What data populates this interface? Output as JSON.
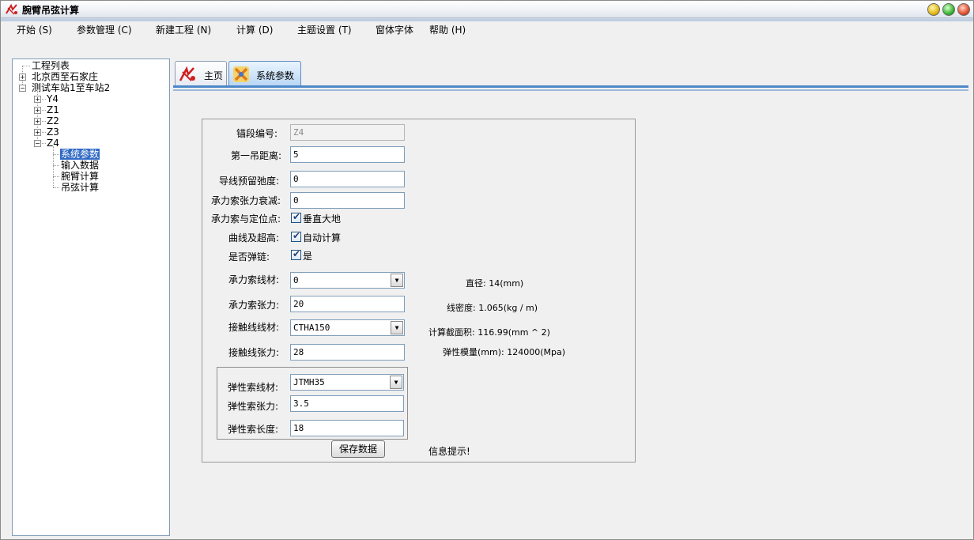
{
  "window": {
    "title": "腕臂吊弦计算"
  },
  "menu": [
    "开始 (S)",
    "参数管理 (C)",
    "新建工程 (N)",
    "计算 (D)",
    "主题设置 (T)",
    "窗体字体",
    "帮助 (H)"
  ],
  "tree": {
    "root": "工程列表",
    "projects": [
      {
        "label": "北京西至石家庄",
        "expander": "+"
      },
      {
        "label": "测试车站1至车站2",
        "expander": "−"
      }
    ],
    "stations": [
      {
        "label": "Y4",
        "expander": "+"
      },
      {
        "label": "Z1",
        "expander": "+"
      },
      {
        "label": "Z2",
        "expander": "+"
      },
      {
        "label": "Z3",
        "expander": "+"
      },
      {
        "label": "Z4",
        "expander": "−"
      }
    ],
    "leaves": [
      "系统参数",
      "输入数据",
      "腕臂计算",
      "吊弦计算"
    ],
    "selected": "系统参数"
  },
  "tabs": [
    {
      "label": "主页"
    },
    {
      "label": "系统参数"
    }
  ],
  "form": {
    "anchor_no": {
      "label": "锚段编号:",
      "value": "Z4"
    },
    "first_hanger_dist": {
      "label": "第一吊距离:",
      "value": "5"
    },
    "contact_sag": {
      "label": "导线预留弛度:",
      "value": "0"
    },
    "messenger_decay": {
      "label": "承力索张力衰减:",
      "value": "0"
    },
    "messenger_locate": {
      "label": "承力索与定位点:",
      "check": "垂直大地"
    },
    "curve_super": {
      "label": "曲线及超高:",
      "check": "自动计算"
    },
    "is_stitch": {
      "label": "是否弹链:",
      "check": "是"
    },
    "messenger_material": {
      "label": "承力索线材:",
      "value": "0"
    },
    "messenger_tension": {
      "label": "承力索张力:",
      "value": "20"
    },
    "contact_material": {
      "label": "接触线线材:",
      "value": "CTHA150"
    },
    "contact_tension": {
      "label": "接触线张力:",
      "value": "28"
    },
    "stitch_material": {
      "label": "弹性索线材:",
      "value": "JTMH35"
    },
    "stitch_tension": {
      "label": "弹性索张力:",
      "value": "3.5"
    },
    "stitch_length": {
      "label": "弹性索长度:",
      "value": "18"
    },
    "save_button": "保存数据",
    "hint": "信息提示!"
  },
  "info": {
    "diameter": "直径: 14(mm)",
    "density": "线密度: 1.065(kg / m)",
    "area": "计算截面积: 116.99(mm ^ 2)",
    "modulus": "弹性模量(mm): 124000(Mpa)"
  },
  "colors": {
    "accent": "#316ac5",
    "tab_line": "#4d88c8"
  }
}
